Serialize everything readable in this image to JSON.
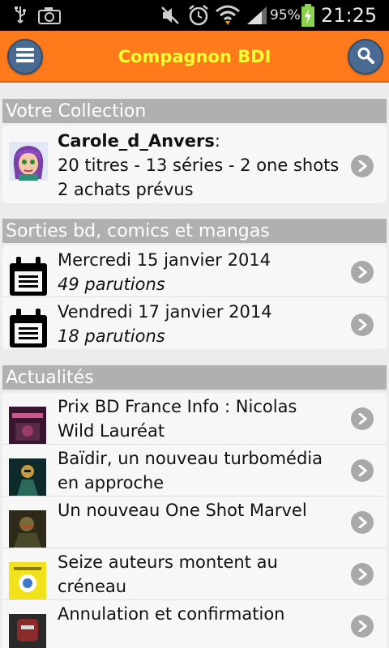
{
  "statusbar": {
    "battery": "95%",
    "time": "21:25"
  },
  "appbar": {
    "title": "Compagnon BDI"
  },
  "collection": {
    "header": "Votre Collection",
    "user": "Carole_d_Anvers",
    "colon": ":",
    "line2": "20 titres - 13 séries - 2 one shots",
    "line3": "2 achats prévus"
  },
  "sorties": {
    "header": "Sorties bd, comics et mangas",
    "items": [
      {
        "date": "Mercredi 15 janvier 2014",
        "count": "49 parutions"
      },
      {
        "date": "Vendredi 17 janvier 2014",
        "count": "18 parutions"
      }
    ]
  },
  "actualites": {
    "header": "Actualités",
    "items": [
      {
        "line1": "Prix BD France Info : Nicolas",
        "line2": "Wild Lauréat"
      },
      {
        "line1": "Baïdir, un nouveau turbomédia",
        "line2": "en approche"
      },
      {
        "line1": "Un nouveau One Shot Marvel",
        "line2": ""
      },
      {
        "line1": "Seize auteurs montent au",
        "line2": "créneau"
      },
      {
        "line1": "Annulation et confirmation",
        "line2": ""
      }
    ]
  },
  "colors": {
    "appbar": "#ff7a1a",
    "title": "#ffff33",
    "section": "#b0b0b0",
    "button": "#4a6b91"
  },
  "icons": {
    "menu": "menu-icon",
    "search": "search-icon",
    "chevron": "chevron-right-icon",
    "calendar": "calendar-icon"
  }
}
